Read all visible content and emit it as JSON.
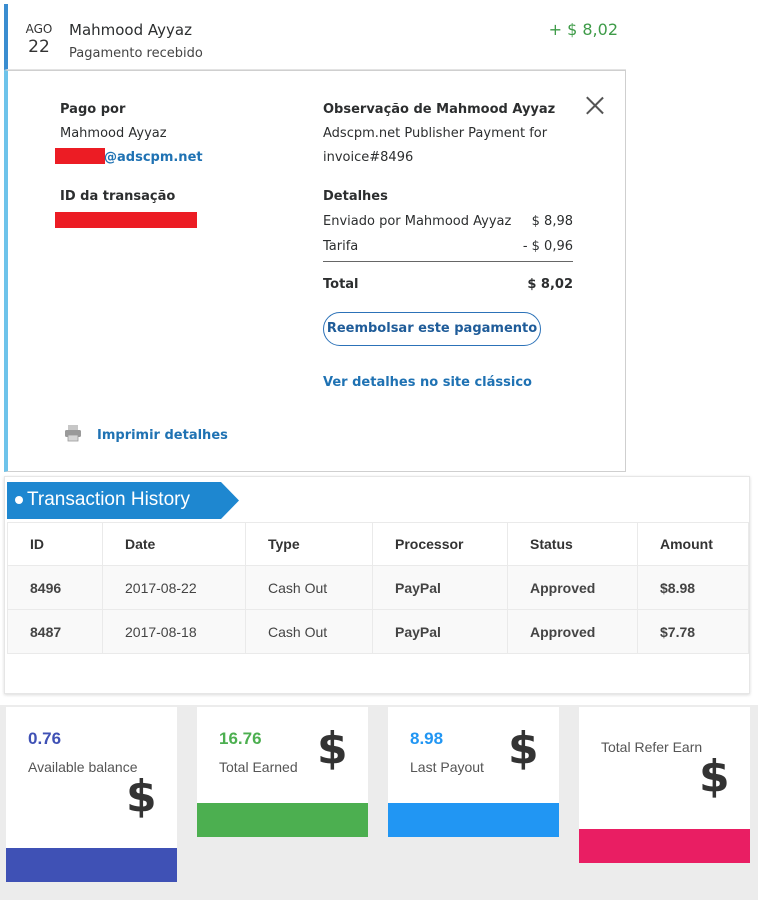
{
  "transaction": {
    "month": "AGO",
    "day": "22",
    "payer_name": "Mahmood Ayyaz",
    "status": "Pagamento recebido",
    "amount": "+ $ 8,02"
  },
  "details": {
    "paid_by_label": "Pago por",
    "paid_by_name": "Mahmood Ayyaz",
    "paid_by_email_suffix": "@adscpm.net",
    "transaction_id_label": "ID da transação",
    "note_label": "Observação de Mahmood Ayyaz",
    "note_line1": "Adscpm.net Publisher Payment for",
    "note_line2": "invoice#8496",
    "details_label": "Detalhes",
    "sent_label": "Enviado por Mahmood Ayyaz",
    "sent_value": "$ 8,98",
    "fee_label": "Tarifa",
    "fee_value": "- $ 0,96",
    "total_label": "Total",
    "total_value": "$ 8,02",
    "refund_button": "Reembolsar este pagamento",
    "classic_link": "Ver detalhes no site clássico",
    "print_link": "Imprimir detalhes"
  },
  "history": {
    "title": "Transaction History",
    "accent_color": "#1e87d0",
    "columns": [
      "ID",
      "Date",
      "Type",
      "Processor",
      "Status",
      "Amount"
    ],
    "rows": [
      [
        "8496",
        "2017-08-22",
        "Cash Out",
        "PayPal",
        "Approved",
        "$8.98"
      ],
      [
        "8487",
        "2017-08-18",
        "Cash Out",
        "PayPal",
        "Approved",
        "$7.78"
      ]
    ]
  },
  "stats": [
    {
      "value": "0.76",
      "label": "Available balance",
      "value_color": "#3f51b5",
      "bar_color": "#3f51b5",
      "icon": "dollar-icon"
    },
    {
      "value": "16.76",
      "label": "Total Earned",
      "value_color": "#4caf50",
      "bar_color": "#4caf50",
      "icon": "dollar-icon"
    },
    {
      "value": "8.98",
      "label": "Last Payout",
      "value_color": "#2196f3",
      "bar_color": "#2196f3",
      "icon": "dollar-icon"
    },
    {
      "value": "",
      "label": "Total Refer Earn",
      "value_color": "#333333",
      "bar_color": "#e91e63",
      "icon": "dollar-icon"
    }
  ],
  "dollar_glyph": "$"
}
